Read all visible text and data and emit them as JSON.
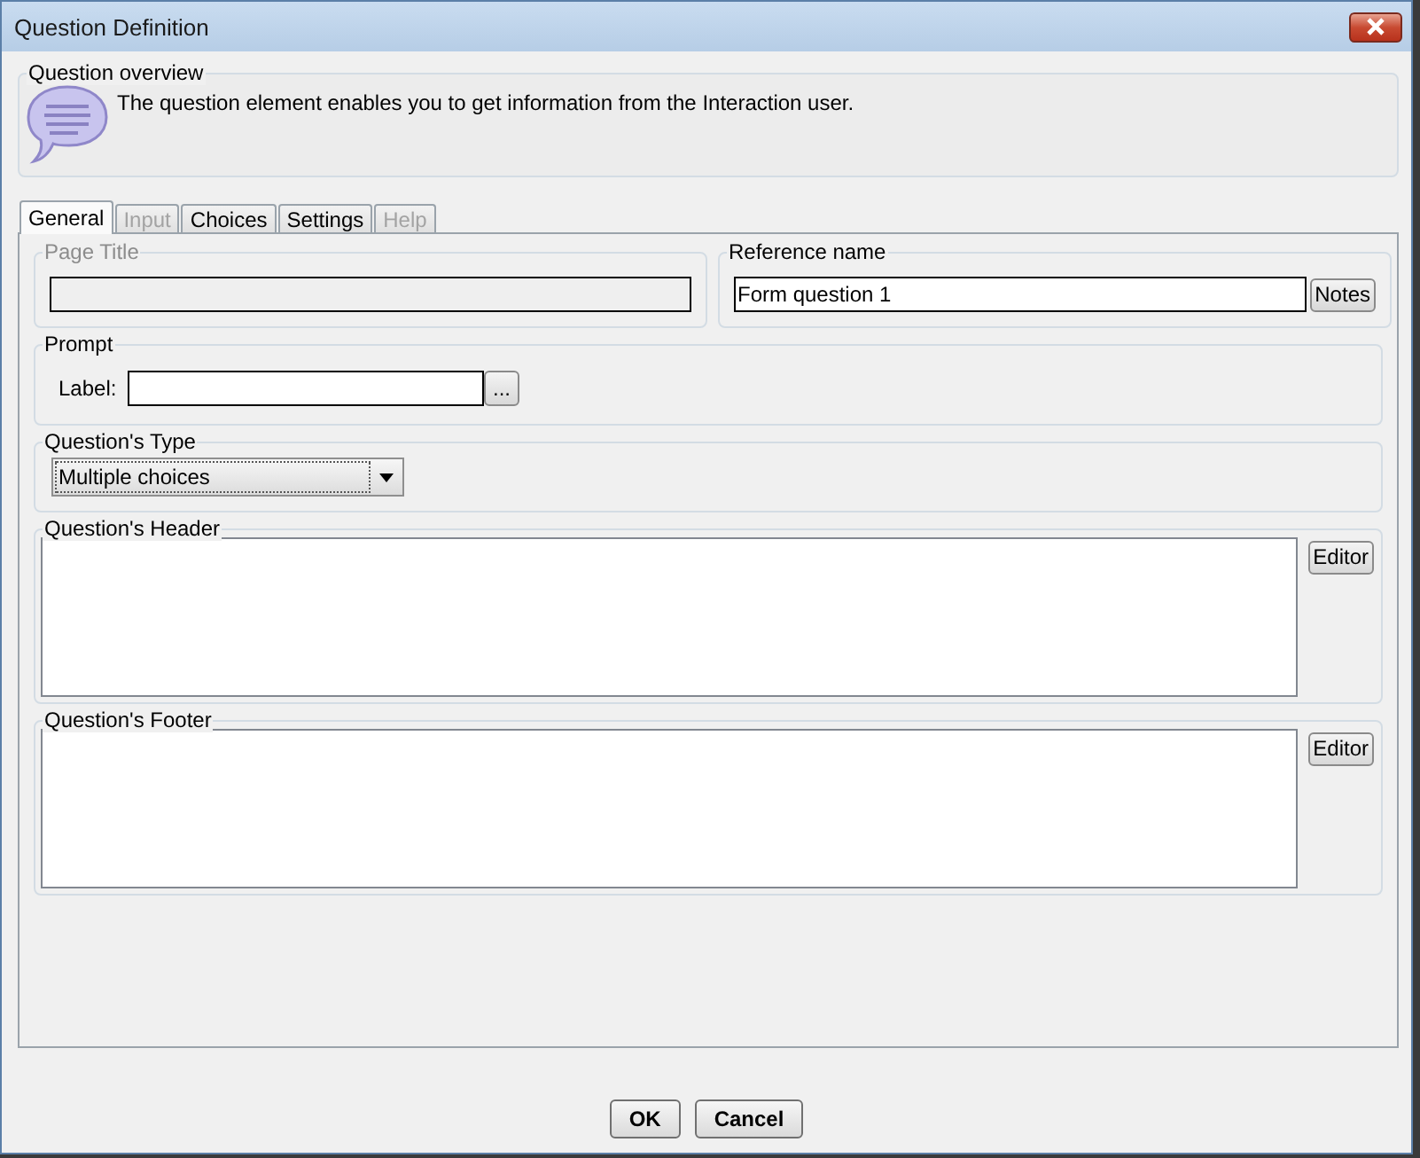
{
  "window": {
    "title": "Question Definition"
  },
  "overview": {
    "title": "Question overview",
    "description": "The question element enables you to get information from the Interaction user."
  },
  "tabs": [
    {
      "label": "General",
      "selected": true,
      "disabled": false
    },
    {
      "label": "Input",
      "selected": false,
      "disabled": true
    },
    {
      "label": "Choices",
      "selected": false,
      "disabled": false
    },
    {
      "label": "Settings",
      "selected": false,
      "disabled": false
    },
    {
      "label": "Help",
      "selected": false,
      "disabled": true
    }
  ],
  "general": {
    "page_title": {
      "label": "Page Title",
      "disabled": true
    },
    "reference_name": {
      "label": "Reference name",
      "value": "Form question 1",
      "button": "Notes"
    },
    "prompt": {
      "label": "Prompt",
      "field_label": "Label:",
      "button": "..."
    },
    "question_type": {
      "label": "Question's Type",
      "value": "Multiple choices"
    },
    "header": {
      "label": "Question's Header",
      "button": "Editor"
    },
    "footer": {
      "label": "Question's Footer",
      "button": "Editor"
    }
  },
  "buttons": [
    "OK",
    "Cancel"
  ]
}
